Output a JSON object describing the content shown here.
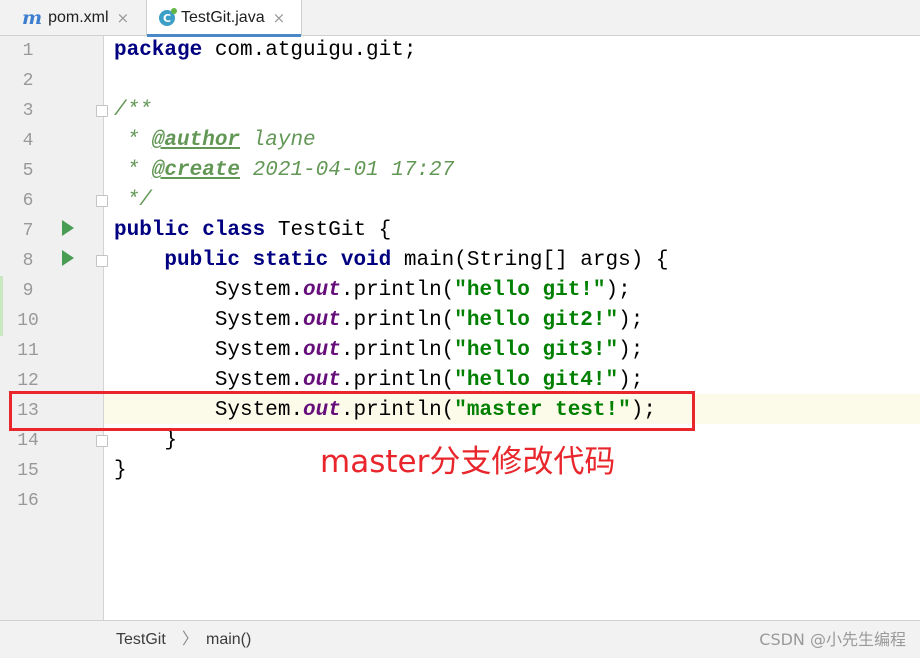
{
  "tabs": [
    {
      "icon": "maven-m-icon",
      "glyph": "m",
      "label": "pom.xml",
      "close": "×"
    },
    {
      "icon": "java-class-icon",
      "glyph": "C",
      "label": "TestGit.java",
      "close": "×"
    }
  ],
  "line_numbers": [
    "1",
    "2",
    "3",
    "4",
    "5",
    "6",
    "7",
    "8",
    "9",
    "10",
    "11",
    "12",
    "13",
    "14",
    "15",
    "16"
  ],
  "code": {
    "l1": {
      "kw": "package",
      "rest": " com.atguigu.git;"
    },
    "l3": "/**",
    "l4": {
      "star": " * ",
      "tag": "@author",
      "val": " layne"
    },
    "l5": {
      "star": " * ",
      "tag": "@create",
      "val": " 2021-04-01 17:27"
    },
    "l6": " */",
    "l7": {
      "kw": "public class",
      "rest": " TestGit {"
    },
    "l8": {
      "indent": "    ",
      "kw": "public static void",
      "rest": " main(String[] args) {"
    },
    "l9": {
      "indent": "        ",
      "pre": "System.",
      "field": "out",
      "mid": ".println(",
      "str": "\"hello git!\"",
      "end": ");"
    },
    "l10": {
      "indent": "        ",
      "pre": "System.",
      "field": "out",
      "mid": ".println(",
      "str": "\"hello git2!\"",
      "end": ");"
    },
    "l11": {
      "indent": "        ",
      "pre": "System.",
      "field": "out",
      "mid": ".println(",
      "str": "\"hello git3!\"",
      "end": ");"
    },
    "l12": {
      "indent": "        ",
      "pre": "System.",
      "field": "out",
      "mid": ".println(",
      "str": "\"hello git4!\"",
      "end": ");"
    },
    "l13": {
      "indent": "        ",
      "pre": "System.",
      "field": "out",
      "mid": ".println(",
      "str": "\"master test!\"",
      "end": ");"
    },
    "l14": "    }",
    "l15": "}"
  },
  "annotation": "master分支修改代码",
  "breadcrumb": {
    "class": "TestGit",
    "sep": "〉",
    "method": "main()"
  },
  "watermark": "CSDN @小先生编程",
  "colors": {
    "highlight_box": "#e8262b",
    "keyword": "#000080",
    "string": "#008000",
    "field": "#660e7a"
  }
}
